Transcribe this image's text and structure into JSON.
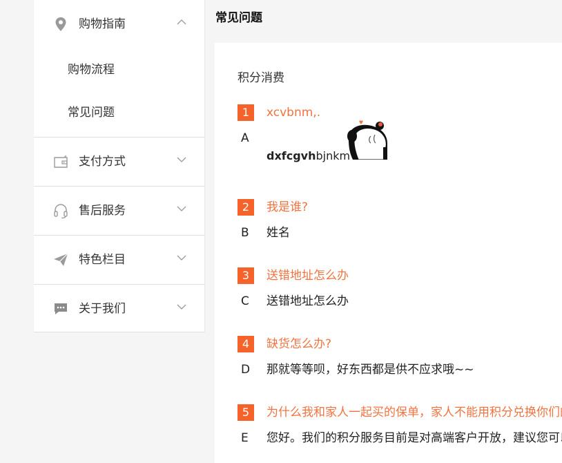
{
  "sidebar": {
    "groups": [
      {
        "label": "购物指南",
        "icon": "location-pin-icon",
        "expanded": true,
        "items": [
          "购物流程",
          "常见问题"
        ]
      },
      {
        "label": "支付方式",
        "icon": "wallet-icon",
        "expanded": false
      },
      {
        "label": "售后服务",
        "icon": "headset-icon",
        "expanded": false
      },
      {
        "label": "特色栏目",
        "icon": "paper-plane-icon",
        "expanded": false
      },
      {
        "label": "关于我们",
        "icon": "chat-bubble-icon",
        "expanded": false
      }
    ]
  },
  "main": {
    "title": "常见问题",
    "section_title": "积分消费",
    "qa": [
      {
        "num": "1",
        "question": "xcvbnm,.",
        "letter": "A",
        "answer_bold": "dxfcgvh",
        "answer_rest": "bjnkm",
        "has_sticker": true
      },
      {
        "num": "2",
        "question": "我是谁?",
        "letter": "B",
        "answer": "姓名"
      },
      {
        "num": "3",
        "question": "送错地址怎么办",
        "letter": "C",
        "answer": "送错地址怎么办"
      },
      {
        "num": "4",
        "question": "缺货怎么办?",
        "letter": "D",
        "answer": "那就等等呗，好东西都是供不应求哦~~"
      },
      {
        "num": "5",
        "question": "为什么我和家人一起买的保单，家人不能用积分兑换你们的产品?",
        "letter": "E",
        "answer": "您好。我们的积分服务目前是对高端客户开放，建议您可以联系客服。"
      }
    ]
  },
  "colors": {
    "accent": "#f5622a",
    "question_text": "#f07340",
    "background": "#f5f5f5",
    "panel": "#ffffff"
  }
}
